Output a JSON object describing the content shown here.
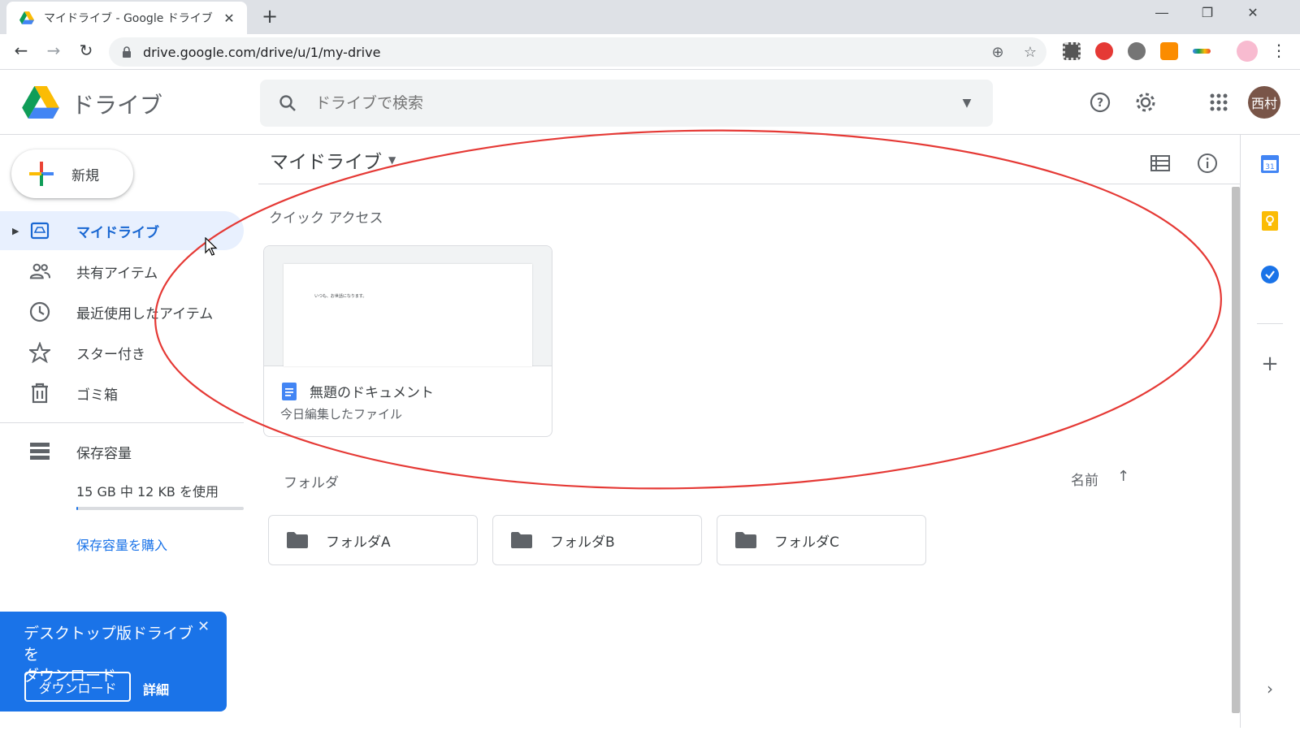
{
  "browser": {
    "tab_title": "マイドライブ - Google ドライブ",
    "tab_close": "✕",
    "new_tab": "+",
    "url": "drive.google.com/drive/u/1/my-drive",
    "window_controls": [
      "minimize-icon",
      "restore-icon",
      "close-icon"
    ]
  },
  "header": {
    "brand": "ドライブ",
    "search_placeholder": "ドライブで検索",
    "avatar_initials": "西村",
    "icons": [
      "help-icon",
      "settings-icon",
      "apps-icon"
    ]
  },
  "sidebar": {
    "new_button": "新規",
    "items": [
      {
        "label": "マイドライブ",
        "icon": "my-drive-icon",
        "active": true
      },
      {
        "label": "共有アイテム",
        "icon": "shared-icon"
      },
      {
        "label": "最近使用したアイテム",
        "icon": "recent-icon"
      },
      {
        "label": "スター付き",
        "icon": "star-icon"
      },
      {
        "label": "ゴミ箱",
        "icon": "trash-icon"
      }
    ],
    "storage": {
      "label": "保存容量",
      "usage": "15 GB 中 12 KB を使用",
      "buy": "保存容量を購入"
    }
  },
  "promo": {
    "text_line1": "デスクトップ版ドライブを",
    "text_line2": "ダウンロード",
    "download_button": "ダウンロード",
    "details": "詳細",
    "close": "✕"
  },
  "main": {
    "title": "マイドライブ",
    "quick_access_label": "クイック アクセス",
    "quick_access_card": {
      "doc_name": "無題のドキュメント",
      "subtitle": "今日編集したファイル",
      "preview_text": "いつも、お世話になります。"
    },
    "folders_label": "フォルダ",
    "sort_label": "名前",
    "folders": [
      "フォルダA",
      "フォルダB",
      "フォルダC"
    ]
  },
  "colors": {
    "accent": "#1a73e8",
    "active_nav_bg": "#e8f0fe",
    "annotation": "#e53935"
  }
}
